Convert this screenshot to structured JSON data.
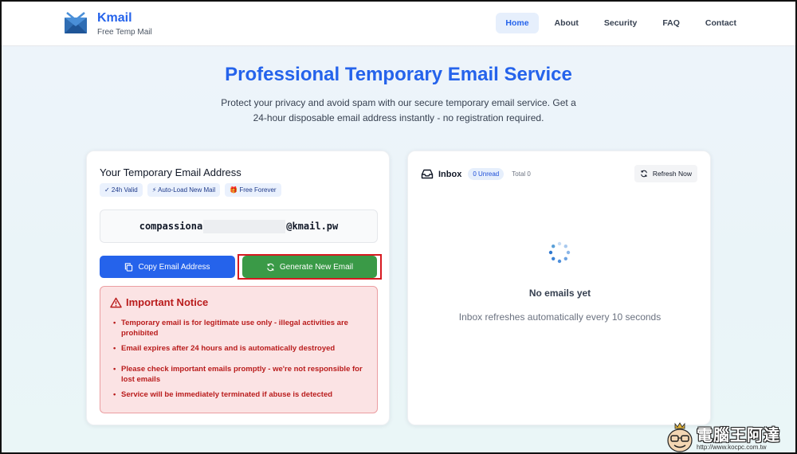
{
  "header": {
    "logo_title": "Kmail",
    "logo_subtitle": "Free Temp Mail",
    "nav": [
      {
        "label": "Home",
        "active": true
      },
      {
        "label": "About"
      },
      {
        "label": "Security"
      },
      {
        "label": "FAQ"
      },
      {
        "label": "Contact"
      }
    ]
  },
  "hero": {
    "title": "Professional Temporary Email Service",
    "subtitle": "Protect your privacy and avoid spam with our secure temporary email service. Get a 24-hour disposable email address instantly - no registration required."
  },
  "email_card": {
    "title": "Your Temporary Email Address",
    "badges": [
      "✓ 24h Valid",
      "⚡ Auto-Load New Mail",
      "🎁 Free Forever"
    ],
    "email_prefix": "compassiona",
    "email_suffix": "@kmail.pw",
    "copy_button": "Copy Email Address",
    "generate_button": "Generate New Email",
    "notice": {
      "title": "Important Notice",
      "items": [
        "Temporary email is for legitimate use only - illegal activities are prohibited",
        "Email expires after 24 hours and is automatically destroyed",
        "Please check important emails promptly - we're not responsible for lost emails",
        "Service will be immediately terminated if abuse is detected"
      ]
    }
  },
  "inbox": {
    "label": "Inbox",
    "unread": "0 Unread",
    "total": "Total 0",
    "refresh_button": "Refresh Now",
    "empty_title": "No emails yet",
    "empty_subtitle": "Inbox refreshes automatically every 10 seconds"
  },
  "watermark": {
    "text": "電腦王阿達",
    "url": "http://www.kocpc.com.tw"
  },
  "colors": {
    "accent": "#2563eb",
    "generate": "#3a9a47",
    "notice_text": "#b91c1c",
    "highlight": "#d71920"
  }
}
